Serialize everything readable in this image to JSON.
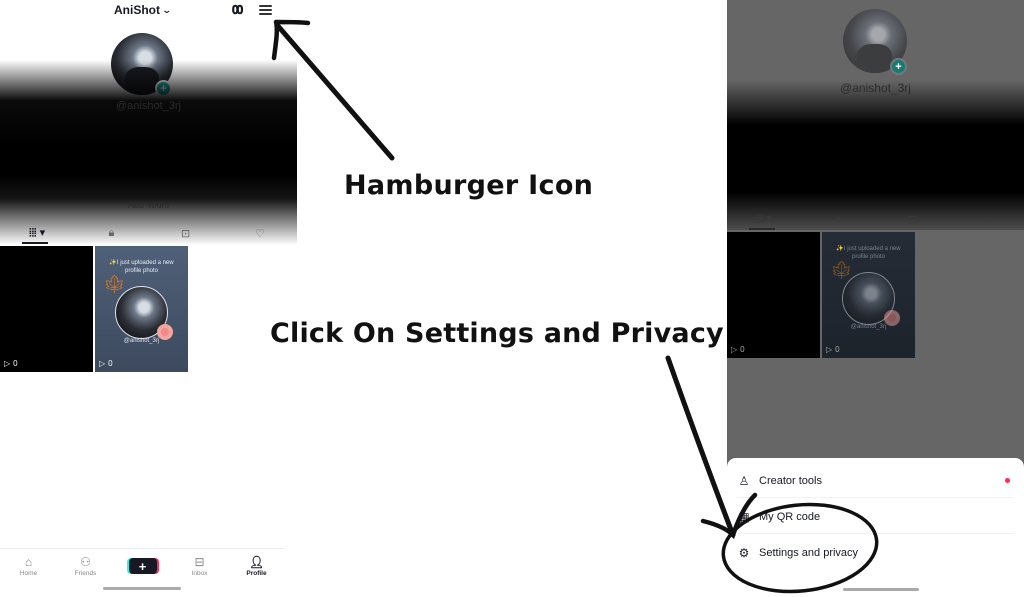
{
  "left_screen": {
    "header": {
      "account_name": "AniShot",
      "chevron_icon": "chevron-down-icon",
      "footprint_icon": "footprint-icon",
      "menu_icon": "hamburger-icon"
    },
    "profile": {
      "username": "@anishot_3rj",
      "add_yours_label": "Add Yours"
    },
    "tabs": [
      {
        "icon": "videos-grid-icon",
        "glyph": "⦙⦙⦙ ▾",
        "active": true
      },
      {
        "icon": "lock-icon",
        "glyph": "🔒︎",
        "active": false
      },
      {
        "icon": "saved-icon",
        "glyph": "⊡",
        "active": false
      },
      {
        "icon": "liked-icon",
        "glyph": "♡",
        "active": false
      }
    ],
    "videos": [
      {
        "style": "black",
        "views": "0"
      },
      {
        "style": "blue",
        "caption": "✨I just uploaded a new profile photo",
        "handle": "@anishot_3rj",
        "views": "0"
      }
    ],
    "bottom_nav": [
      {
        "label": "Home",
        "icon": "home-icon",
        "glyph": "⌂"
      },
      {
        "label": "Friends",
        "icon": "friends-icon",
        "glyph": "⚇"
      },
      {
        "label": "",
        "icon": "create-plus-icon",
        "glyph": "+"
      },
      {
        "label": "Inbox",
        "icon": "inbox-icon",
        "glyph": "⊟"
      },
      {
        "label": "Profile",
        "icon": "profile-icon",
        "glyph": "👤︎",
        "active": true
      }
    ]
  },
  "annotations": {
    "hamburger_label": "Hamburger Icon",
    "settings_label": "Click On Settings and Privacy"
  },
  "right_screen": {
    "profile": {
      "username": "@anishot_3rj"
    },
    "videos": [
      {
        "style": "black",
        "views": "0"
      },
      {
        "style": "blue",
        "caption": "✨I just uploaded a new profile photo",
        "handle": "@anishot_3rj",
        "views": "0"
      }
    ],
    "menu_sheet": {
      "items": [
        {
          "label": "Creator tools",
          "icon": "creator-tools-icon",
          "glyph": "♙",
          "has_notification_dot": true
        },
        {
          "label": "My QR code",
          "icon": "qr-code-icon",
          "glyph": "▦"
        },
        {
          "label": "Settings and privacy",
          "icon": "settings-gear-icon",
          "glyph": "⚙"
        }
      ],
      "notification_color": "#fe2c55"
    }
  },
  "colors": {
    "accent_teal": "#20b2aa",
    "overlay_gray": "#666666",
    "text_primary": "#161823"
  }
}
